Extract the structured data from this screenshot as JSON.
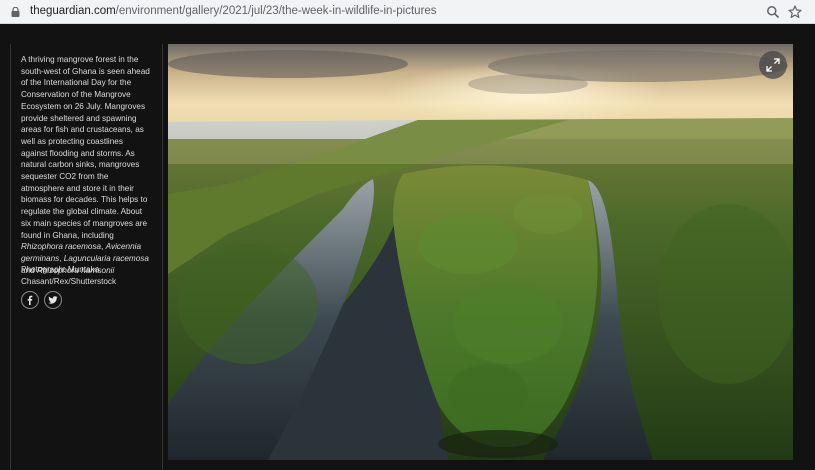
{
  "browser": {
    "url_host": "theguardian.com",
    "url_path": "/environment/gallery/2021/jul/23/the-week-in-wildlife-in-pictures",
    "icons": [
      "lock-icon",
      "zoom-icon",
      "bookmark-star-icon"
    ]
  },
  "gallery": {
    "caption": {
      "intro": "A thriving mangrove forest in the south-west of Ghana is seen ahead of the International Day for the Conservation of the Mangrove Ecosystem on 26 July. Mangroves provide sheltered and spawning areas for fish and crustaceans, as well as protecting coastlines against flooding and storms. As natural carbon sinks, mangroves sequester CO2 from the atmosphere and store it in their biomass for decades. This helps to regulate the global climate. About six main species of mangroves are found in Ghana, including ",
      "species_1": "Rhizophora racemosa",
      "sep_1": ", ",
      "species_2": "Avicennia germinans",
      "sep_2": ", ",
      "species_3": "Laguncularia racemosa",
      "sep_3": " and ",
      "species_4": "Rhizophora harrisonii"
    },
    "credit": "Photograph: Muntaka Chasant/Rex/Shutterstock",
    "share": {
      "facebook_icon": "f",
      "twitter_icon": "twitter-bird-icon"
    },
    "photo": {
      "subject": "aerial-mangrove-forest-photo",
      "expand_icon": "expand-arrows-icon"
    },
    "colors": {
      "background": "#121212",
      "caption_text": "#dcdcdc",
      "urlbar": "#f1f3f4"
    }
  }
}
